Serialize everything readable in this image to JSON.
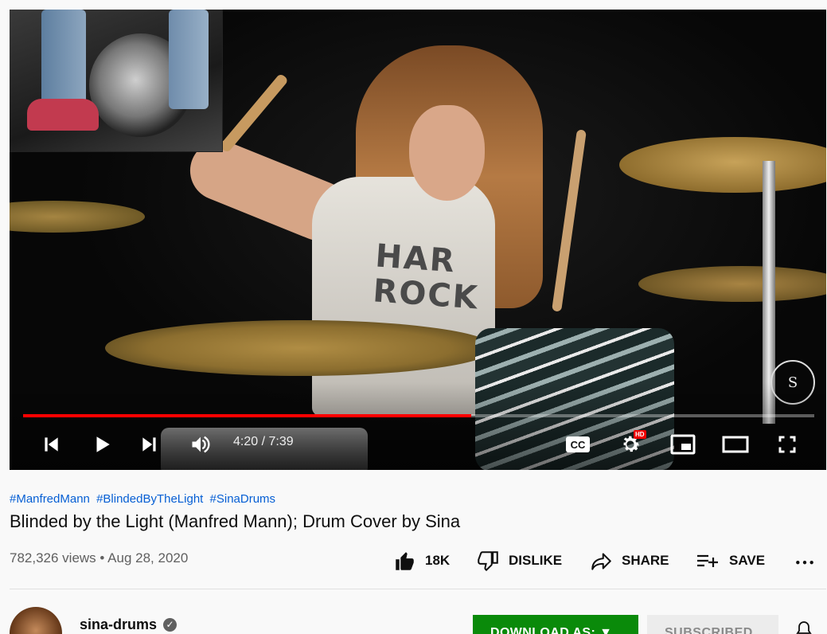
{
  "player": {
    "current_time": "4:20 / 7:39",
    "progress_fraction": 0.5664,
    "hd_badge": "HD",
    "shirt_text_line1": "HAR",
    "shirt_text_line2": "ROCK",
    "watermark_text": "S",
    "accent_color": "#ff0000"
  },
  "video": {
    "hashtags": [
      "#ManfredMann",
      "#BlindedByTheLight",
      "#SinaDrums"
    ],
    "title": "Blinded by the Light (Manfred Mann); Drum Cover by Sina",
    "views": "782,326 views",
    "date": "Aug 28, 2020"
  },
  "actions": {
    "like_count": "18K",
    "dislike_label": "DISLIKE",
    "share_label": "SHARE",
    "save_label": "SAVE"
  },
  "channel": {
    "name": "sina-drums",
    "download_label": "DOWNLOAD AS:",
    "subscribe_label": "SUBSCRIBED"
  },
  "icons": {
    "prev": "skip-previous-icon",
    "play": "play-icon",
    "next": "skip-next-icon",
    "volume": "volume-icon",
    "cc": "captions-icon",
    "settings": "gear-icon",
    "miniplayer": "miniplayer-icon",
    "theater": "theater-icon",
    "fullscreen": "fullscreen-icon"
  }
}
